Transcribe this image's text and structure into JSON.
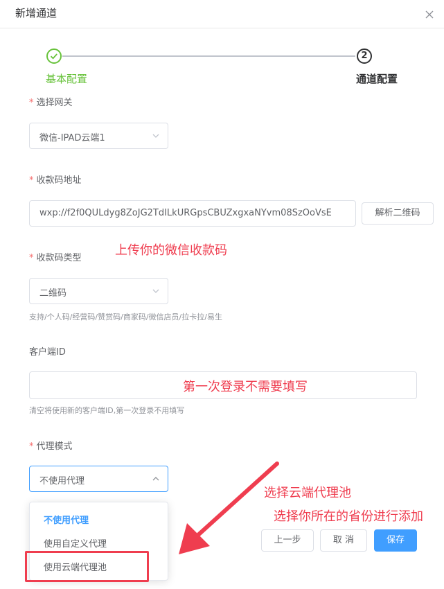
{
  "dialog": {
    "title": "新增通道"
  },
  "steps": [
    {
      "label": "基本配置",
      "status": "done"
    },
    {
      "label": "通道配置",
      "number": "2",
      "status": "current"
    }
  ],
  "form": {
    "gateway": {
      "label": "选择网关",
      "required": "*",
      "value": "微信-IPAD云端1"
    },
    "payment_code_url": {
      "label": "收款码地址",
      "required": "*",
      "value": "wxp://f2f0QULdyg8ZoJG2TdILkURGpsCBUZxgxaNYvm08SzOoVsE",
      "parse_button": "解析二维码"
    },
    "payment_code_type": {
      "label": "收款码类型",
      "required": "*",
      "value": "二维码",
      "hint": "支持/个人码/经营码/赞赏码/商家码/微信店员/拉卡拉/易生"
    },
    "client_id": {
      "label": "客户端ID",
      "value": "",
      "hint": "清空将使用新的客户端ID,第一次登录不用填写"
    },
    "proxy_mode": {
      "label": "代理模式",
      "required": "*",
      "value": "不使用代理",
      "options": [
        "不使用代理",
        "使用自定义代理",
        "使用云端代理池"
      ],
      "selected_index": 0
    }
  },
  "footer": {
    "prev": "上一步",
    "cancel": "取 消",
    "save": "保存"
  },
  "annotations": {
    "upload_note": "上传你的微信收款码",
    "first_login_note": "第一次登录不需要填写",
    "select_pool_note": "选择云端代理池",
    "add_region_note": "选择你所在的省份进行添加"
  },
  "colors": {
    "primary": "#409eff",
    "success": "#67c23a",
    "annotation": "#ef3d4f"
  }
}
